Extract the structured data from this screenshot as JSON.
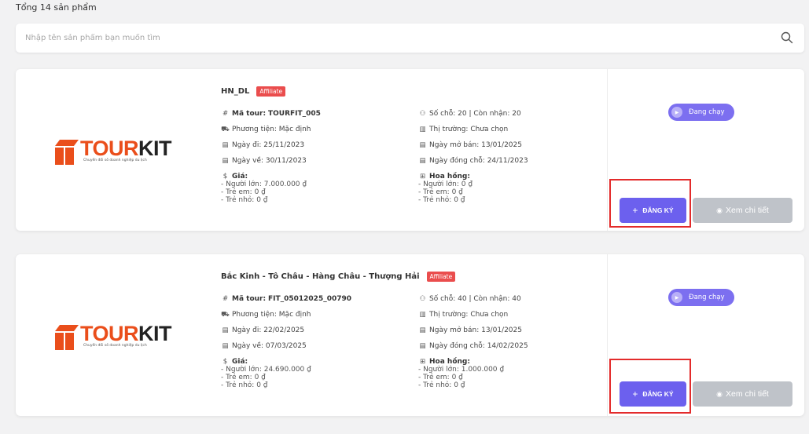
{
  "summary": {
    "total_label": "Tổng 14 sản phẩm"
  },
  "search": {
    "placeholder": "Nhập tên sản phẩm bạn muốn tìm"
  },
  "colors": {
    "accent": "#6c60ee",
    "badge": "#ea4d4d",
    "highlight": "#e32b2b",
    "brand": "#ea4e1b"
  },
  "logo": {
    "text_primary": "TOUR",
    "text_secondary": "KIT",
    "tagline": "Chuyển đổi số doanh nghiệp du lịch"
  },
  "products": [
    {
      "title": "HN_DL",
      "badge": "Affiliate",
      "tour_code_label": "Mã tour:",
      "tour_code": "TOURFIT_005",
      "vehicle": "Phương tiện: Mặc định",
      "depart": "Ngày đi: 25/11/2023",
      "return": "Ngày về: 30/11/2023",
      "price_title": "Giá:",
      "price_lines": [
        "- Người lớn: 7.000.000 ₫",
        "- Trẻ em: 0 ₫",
        "- Trẻ nhỏ: 0 ₫"
      ],
      "seats": "Số chỗ: 20 | Còn nhận: 20",
      "market": "Thị trường: Chưa chọn",
      "sale_open": "Ngày mở bán: 13/01/2025",
      "seat_close": "Ngày đóng chỗ: 24/11/2023",
      "commission_title": "Hoa hồng:",
      "commission_lines": [
        "- Người lớn: 0 ₫",
        "- Trẻ em: 0 ₫",
        "- Trẻ nhỏ: 0 ₫"
      ],
      "status": "Đang chạy",
      "register_label": "ĐĂNG KÝ",
      "detail_label": "Xem chi tiết"
    },
    {
      "title": "Bắc Kinh - Tô Châu - Hàng Châu - Thượng Hải",
      "badge": "Affiliate",
      "tour_code_label": "Mã tour:",
      "tour_code": "FIT_05012025_00790",
      "vehicle": "Phương tiện: Mặc định",
      "depart": "Ngày đi: 22/02/2025",
      "return": "Ngày về: 07/03/2025",
      "price_title": "Giá:",
      "price_lines": [
        "- Người lớn: 24.690.000 ₫",
        "- Trẻ em: 0 ₫",
        "- Trẻ nhỏ: 0 ₫"
      ],
      "seats": "Số chỗ: 40 | Còn nhận: 40",
      "market": "Thị trường: Chưa chọn",
      "sale_open": "Ngày mở bán: 13/01/2025",
      "seat_close": "Ngày đóng chỗ: 14/02/2025",
      "commission_title": "Hoa hồng:",
      "commission_lines": [
        "- Người lớn: 1.000.000 ₫",
        "- Trẻ em: 0 ₫",
        "- Trẻ nhỏ: 0 ₫"
      ],
      "status": "Đang chạy",
      "register_label": "ĐĂNG KÝ",
      "detail_label": "Xem chi tiết"
    }
  ]
}
